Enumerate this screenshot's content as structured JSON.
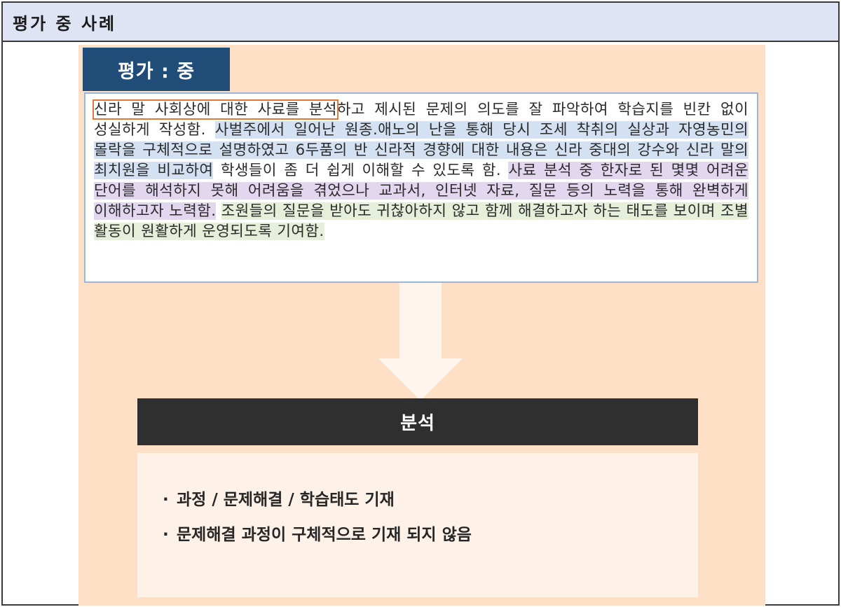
{
  "header": {
    "title": "평가 중 사례"
  },
  "eval_tab": {
    "label": "평가 : 중"
  },
  "paragraph": {
    "seg1": "신라 말 사회상에 대한 사료를 분석",
    "seg2": "하고 제시된 문제의 의도를 잘 파악하여 학습지를 빈칸 없이 성실하게 작성함.",
    "seg3": "사벌주에서 일어난 원종.애노의 난을 통해 당시 조세 착취의 실상과 자영농민의 몰락을 구체적으로 설명하였고 6두품의 반 신라적 경향에 대한 내용은 신라 중대의 강수와 신라 말의 최치원을 비교하여",
    "seg4": "학생들이 좀 더 쉽게 이해할 수 있도록 함.",
    "seg5": "사료 분석 중 한자로 된 몇몇 어려운 단어를 해석하지 못해 어려움을 겪었으나 교과서, 인터넷 자료, 질문 등의 노력을 통해 완벽하게 이해하고자 노력함.",
    "seg6": "조원들의 질문을 받아도 귀찮아하지 않고 함께 해결하고자 하는 태도를 보이며 조별 활동이 원활하게 운영되도록 기여함."
  },
  "analysis": {
    "title": "분석",
    "bullets": [
      "과정 / 문제해결 / 학습태도 기재",
      "문제해결 과정이 구체적으로 기재 되지 않음"
    ],
    "bullet_marker": "·"
  },
  "colors": {
    "header_bg": "#dfe4f5",
    "panel_bg": "#fde0c5",
    "eval_tab_bg": "#1f4d78",
    "analysis_bar_bg": "#2f2f2f",
    "highlight_blue": "#d4e1f2",
    "highlight_purple": "#e3d7f0",
    "highlight_green": "#e5efda",
    "outline_orange": "#e07a3a"
  }
}
